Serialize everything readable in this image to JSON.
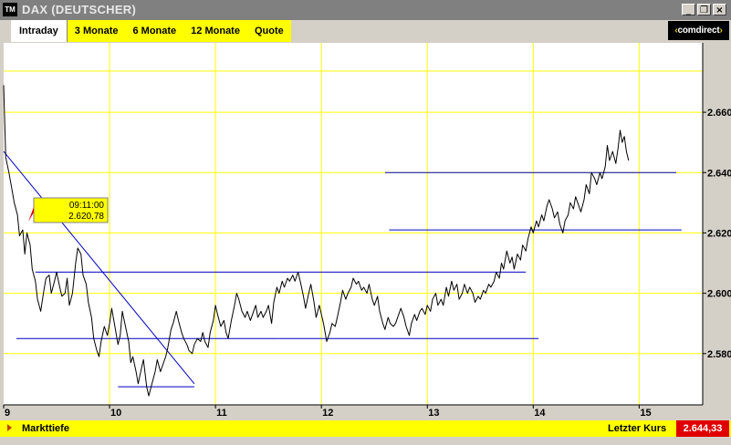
{
  "window": {
    "icon_text": "TM",
    "title": "DAX (DEUTSCHER)",
    "minimize": "_",
    "restore": "❐",
    "close": "×"
  },
  "tabs": [
    {
      "label": "Intraday",
      "active": true
    },
    {
      "label": "3 Monate",
      "active": false
    },
    {
      "label": "6 Monate",
      "active": false
    },
    {
      "label": "12 Monate",
      "active": false
    },
    {
      "label": "Quote",
      "active": false
    }
  ],
  "brand": {
    "prefix": "‹",
    "name": "comdirect",
    "suffix": "›"
  },
  "tooltip": {
    "time": "09:11:00",
    "value": "2.620,78"
  },
  "footer": {
    "left_label": "Markttiefe",
    "right_label": "Letzter Kurs",
    "last_price": "2.644,33"
  },
  "colors": {
    "chart_background": "#ffffff",
    "grid": "#ffff00",
    "plot_line": "#000000",
    "trend_lines": "#0000c0",
    "tooltip_background": "#ffff00",
    "last_price_background": "#e00000"
  },
  "chart_data": {
    "type": "line",
    "x_tick_labels": [
      "9",
      "10",
      "11",
      "12",
      "13",
      "14",
      "15"
    ],
    "y_tick_labels": [
      "2.580",
      "2.600",
      "2.620",
      "2.640",
      "2.660"
    ],
    "y_ticks": [
      2580,
      2600,
      2620,
      2640,
      2660
    ],
    "xlim": [
      9,
      15.6
    ],
    "ylim": [
      2563,
      2683
    ],
    "grid": true,
    "y_axis_side": "right",
    "series": [
      {
        "values": [
          [
            9.0,
            2669
          ],
          [
            9.02,
            2645
          ],
          [
            9.05,
            2640
          ],
          [
            9.08,
            2634
          ],
          [
            9.1,
            2630
          ],
          [
            9.13,
            2626
          ],
          [
            9.15,
            2619
          ],
          [
            9.18,
            2621
          ],
          [
            9.2,
            2613
          ],
          [
            9.22,
            2620
          ],
          [
            9.25,
            2616
          ],
          [
            9.27,
            2608
          ],
          [
            9.3,
            2604
          ],
          [
            9.32,
            2598
          ],
          [
            9.35,
            2594
          ],
          [
            9.38,
            2601
          ],
          [
            9.4,
            2605
          ],
          [
            9.43,
            2606
          ],
          [
            9.45,
            2600
          ],
          [
            9.48,
            2604
          ],
          [
            9.5,
            2607
          ],
          [
            9.53,
            2602
          ],
          [
            9.55,
            2599
          ],
          [
            9.58,
            2600
          ],
          [
            9.6,
            2605
          ],
          [
            9.62,
            2596
          ],
          [
            9.65,
            2600
          ],
          [
            9.68,
            2610
          ],
          [
            9.7,
            2615
          ],
          [
            9.73,
            2613
          ],
          [
            9.75,
            2606
          ],
          [
            9.78,
            2603
          ],
          [
            9.8,
            2597
          ],
          [
            9.83,
            2592
          ],
          [
            9.85,
            2585
          ],
          [
            9.88,
            2581
          ],
          [
            9.9,
            2579
          ],
          [
            9.92,
            2584
          ],
          [
            9.95,
            2589
          ],
          [
            9.98,
            2586
          ],
          [
            10.0,
            2590
          ],
          [
            10.02,
            2595
          ],
          [
            10.05,
            2589
          ],
          [
            10.08,
            2583
          ],
          [
            10.1,
            2586
          ],
          [
            10.12,
            2594
          ],
          [
            10.15,
            2589
          ],
          [
            10.18,
            2584
          ],
          [
            10.2,
            2577
          ],
          [
            10.22,
            2579
          ],
          [
            10.25,
            2574
          ],
          [
            10.27,
            2570
          ],
          [
            10.3,
            2575
          ],
          [
            10.32,
            2578
          ],
          [
            10.35,
            2569
          ],
          [
            10.37,
            2566
          ],
          [
            10.4,
            2570
          ],
          [
            10.43,
            2574
          ],
          [
            10.45,
            2578
          ],
          [
            10.48,
            2574
          ],
          [
            10.5,
            2576
          ],
          [
            10.53,
            2579
          ],
          [
            10.55,
            2582
          ],
          [
            10.58,
            2588
          ],
          [
            10.6,
            2590
          ],
          [
            10.63,
            2594
          ],
          [
            10.65,
            2591
          ],
          [
            10.68,
            2587
          ],
          [
            10.7,
            2585
          ],
          [
            10.73,
            2583
          ],
          [
            10.75,
            2581
          ],
          [
            10.78,
            2580
          ],
          [
            10.8,
            2583
          ],
          [
            10.83,
            2585
          ],
          [
            10.86,
            2584
          ],
          [
            10.88,
            2587
          ],
          [
            10.9,
            2584
          ],
          [
            10.93,
            2582
          ],
          [
            10.95,
            2587
          ],
          [
            10.98,
            2591
          ],
          [
            11.0,
            2596
          ],
          [
            11.02,
            2593
          ],
          [
            11.05,
            2589
          ],
          [
            11.08,
            2591
          ],
          [
            11.1,
            2587
          ],
          [
            11.12,
            2585
          ],
          [
            11.15,
            2591
          ],
          [
            11.18,
            2596
          ],
          [
            11.2,
            2600
          ],
          [
            11.22,
            2598
          ],
          [
            11.25,
            2594
          ],
          [
            11.28,
            2592
          ],
          [
            11.3,
            2594
          ],
          [
            11.33,
            2591
          ],
          [
            11.35,
            2593
          ],
          [
            11.38,
            2596
          ],
          [
            11.4,
            2592
          ],
          [
            11.43,
            2594
          ],
          [
            11.45,
            2592
          ],
          [
            11.48,
            2594
          ],
          [
            11.5,
            2596
          ],
          [
            11.53,
            2590
          ],
          [
            11.55,
            2597
          ],
          [
            11.58,
            2602
          ],
          [
            11.6,
            2600
          ],
          [
            11.63,
            2604
          ],
          [
            11.65,
            2602
          ],
          [
            11.68,
            2605
          ],
          [
            11.7,
            2604
          ],
          [
            11.73,
            2606
          ],
          [
            11.75,
            2604
          ],
          [
            11.78,
            2607
          ],
          [
            11.8,
            2604
          ],
          [
            11.83,
            2599
          ],
          [
            11.85,
            2595
          ],
          [
            11.88,
            2600
          ],
          [
            11.9,
            2603
          ],
          [
            11.93,
            2597
          ],
          [
            11.95,
            2592
          ],
          [
            11.98,
            2596
          ],
          [
            12.0,
            2593
          ],
          [
            12.02,
            2590
          ],
          [
            12.05,
            2584
          ],
          [
            12.08,
            2587
          ],
          [
            12.1,
            2590
          ],
          [
            12.13,
            2589
          ],
          [
            12.15,
            2592
          ],
          [
            12.18,
            2597
          ],
          [
            12.2,
            2601
          ],
          [
            12.23,
            2598
          ],
          [
            12.25,
            2600
          ],
          [
            12.28,
            2602
          ],
          [
            12.3,
            2605
          ],
          [
            12.33,
            2603
          ],
          [
            12.35,
            2604
          ],
          [
            12.38,
            2601
          ],
          [
            12.4,
            2602
          ],
          [
            12.43,
            2600
          ],
          [
            12.45,
            2603
          ],
          [
            12.48,
            2598
          ],
          [
            12.5,
            2596
          ],
          [
            12.53,
            2599
          ],
          [
            12.55,
            2594
          ],
          [
            12.58,
            2590
          ],
          [
            12.6,
            2588
          ],
          [
            12.63,
            2592
          ],
          [
            12.65,
            2590
          ],
          [
            12.68,
            2589
          ],
          [
            12.7,
            2590
          ],
          [
            12.73,
            2593
          ],
          [
            12.75,
            2595
          ],
          [
            12.78,
            2592
          ],
          [
            12.8,
            2589
          ],
          [
            12.83,
            2586
          ],
          [
            12.85,
            2590
          ],
          [
            12.88,
            2593
          ],
          [
            12.9,
            2591
          ],
          [
            12.93,
            2594
          ],
          [
            12.95,
            2595
          ],
          [
            12.98,
            2593
          ],
          [
            13.0,
            2596
          ],
          [
            13.03,
            2594
          ],
          [
            13.05,
            2598
          ],
          [
            13.08,
            2600
          ],
          [
            13.1,
            2596
          ],
          [
            13.13,
            2598
          ],
          [
            13.15,
            2596
          ],
          [
            13.18,
            2602
          ],
          [
            13.2,
            2599
          ],
          [
            13.23,
            2604
          ],
          [
            13.25,
            2601
          ],
          [
            13.28,
            2603
          ],
          [
            13.3,
            2598
          ],
          [
            13.33,
            2600
          ],
          [
            13.35,
            2603
          ],
          [
            13.38,
            2600
          ],
          [
            13.4,
            2602
          ],
          [
            13.43,
            2600
          ],
          [
            13.45,
            2597
          ],
          [
            13.48,
            2599
          ],
          [
            13.5,
            2598
          ],
          [
            13.53,
            2601
          ],
          [
            13.55,
            2600
          ],
          [
            13.58,
            2603
          ],
          [
            13.6,
            2602
          ],
          [
            13.63,
            2604
          ],
          [
            13.65,
            2607
          ],
          [
            13.68,
            2605
          ],
          [
            13.7,
            2610
          ],
          [
            13.72,
            2608
          ],
          [
            13.75,
            2614
          ],
          [
            13.78,
            2610
          ],
          [
            13.8,
            2612
          ],
          [
            13.82,
            2608
          ],
          [
            13.85,
            2613
          ],
          [
            13.88,
            2611
          ],
          [
            13.9,
            2616
          ],
          [
            13.93,
            2614
          ],
          [
            13.95,
            2618
          ],
          [
            13.98,
            2622
          ],
          [
            14.0,
            2620
          ],
          [
            14.03,
            2624
          ],
          [
            14.05,
            2622
          ],
          [
            14.08,
            2626
          ],
          [
            14.1,
            2624
          ],
          [
            14.13,
            2629
          ],
          [
            14.15,
            2631
          ],
          [
            14.18,
            2628
          ],
          [
            14.2,
            2625
          ],
          [
            14.23,
            2627
          ],
          [
            14.25,
            2623
          ],
          [
            14.28,
            2620
          ],
          [
            14.3,
            2624
          ],
          [
            14.33,
            2626
          ],
          [
            14.35,
            2630
          ],
          [
            14.38,
            2628
          ],
          [
            14.4,
            2632
          ],
          [
            14.43,
            2629
          ],
          [
            14.45,
            2627
          ],
          [
            14.48,
            2631
          ],
          [
            14.5,
            2636
          ],
          [
            14.53,
            2633
          ],
          [
            14.55,
            2640
          ],
          [
            14.58,
            2638
          ],
          [
            14.6,
            2636
          ],
          [
            14.63,
            2640
          ],
          [
            14.65,
            2638
          ],
          [
            14.68,
            2642
          ],
          [
            14.7,
            2649
          ],
          [
            14.72,
            2644
          ],
          [
            14.75,
            2647
          ],
          [
            14.78,
            2643
          ],
          [
            14.8,
            2648
          ],
          [
            14.82,
            2654
          ],
          [
            14.84,
            2650
          ],
          [
            14.86,
            2652
          ],
          [
            14.88,
            2647
          ],
          [
            14.9,
            2644
          ]
        ]
      }
    ],
    "trend_lines": [
      [
        [
          9.0,
          2647
        ],
        [
          10.8,
          2570
        ]
      ],
      [
        [
          10.08,
          2569
        ],
        [
          10.8,
          2569
        ]
      ],
      [
        [
          9.12,
          2585
        ],
        [
          11.6,
          2585
        ]
      ],
      [
        [
          11.6,
          2585
        ],
        [
          14.05,
          2585
        ]
      ],
      [
        [
          9.3,
          2607
        ],
        [
          13.93,
          2607
        ]
      ],
      [
        [
          12.64,
          2621
        ],
        [
          15.4,
          2621
        ]
      ],
      [
        [
          12.6,
          2640
        ],
        [
          15.35,
          2640
        ]
      ]
    ]
  }
}
